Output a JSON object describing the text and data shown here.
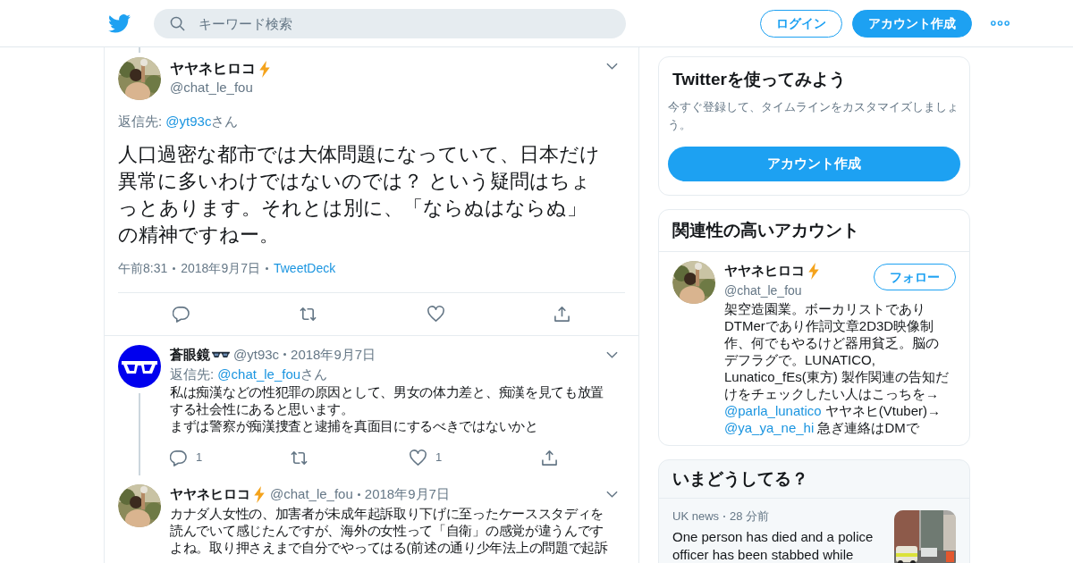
{
  "header": {
    "search": {
      "placeholder": "キーワード検索"
    },
    "buttons": [
      {
        "kind": "outline",
        "label": "ログイン"
      },
      {
        "kind": "filled",
        "label": "アカウント作成"
      }
    ]
  },
  "main_tweet": {
    "name": "ヤヤネヒロコ",
    "handle": "@chat_le_fou",
    "reply_prefix": "返信先: ",
    "reply_mention": "@yt93c",
    "reply_suffix": "さん",
    "text_lines": [
      "人口過密な都市では大体問題になっていて、日本だけ",
      "異常に多いわけではないのでは？ という疑問はちょ",
      "っとあります。それとは別に、「ならぬはならぬ」",
      "の精神ですねー。"
    ],
    "time": "午前8:31",
    "date": "2018年9月7日",
    "source": "TweetDeck"
  },
  "replies": [
    {
      "name": "蒼眼鏡",
      "handle": "@yt93c",
      "date": "2018年9月7日",
      "reply_prefix": "返信先: ",
      "reply_mention": "@chat_le_fou",
      "reply_suffix": "さん",
      "text_lines": [
        "私は痴漢などの性犯罪の原因として、男女の体力差と、痴漢を見ても放置",
        "する社会性にあると思います。",
        "まずは警察が痴漢捜査と逮捕を真面目にするべきではないかと"
      ],
      "reply_count": "1",
      "like_count": "1"
    },
    {
      "name": "ヤヤネヒロコ",
      "handle": "@chat_le_fou",
      "date": "2018年9月7日",
      "text_lines": [
        "カナダ人女性の、加害者が未成年起訴取り下げに至ったケーススタディを",
        "読んでいて感じたんですが、海外の女性って「自衛」の感覚が違うんです",
        "よね。取り押さえまで自分でやってはる(前述の通り少年法上の問題で起訴"
      ]
    }
  ],
  "signup_card": {
    "title": "Twitterを使ってみよう",
    "subtitle": "今すぐ登録して、タイムラインをカスタマイズしましょう。",
    "button": "アカウント作成"
  },
  "related_card": {
    "title": "関連性の高いアカウント",
    "account": {
      "name": "ヤヤネヒロコ",
      "handle": "@chat_le_fou",
      "follow": "フォロー",
      "bio": [
        {
          "kind": "text",
          "text": "架空造園業。ボーカリストでありDTMerであり作詞文章2D3D映像制作、何でもやるけど器用貧乏。脳のデフラグで。LUNATICO, Lunatico_fEs(東方) 製作関連の告知だけをチェックしたい人はこっちを→ "
        },
        {
          "kind": "mention",
          "text": "@parla_lunatico"
        },
        {
          "kind": "text",
          "text": " ヤヤネヒ(Vtuber)→ "
        },
        {
          "kind": "mention",
          "text": "@ya_ya_ne_hi"
        },
        {
          "kind": "text",
          "text": " 急ぎ連絡はDMで"
        }
      ]
    }
  },
  "trends_card": {
    "title": "いまどうしてる？",
    "items": [
      {
        "category": "UK news",
        "age": "28 分前",
        "headline": "One person has died and a police officer has been stabbed while"
      }
    ]
  }
}
